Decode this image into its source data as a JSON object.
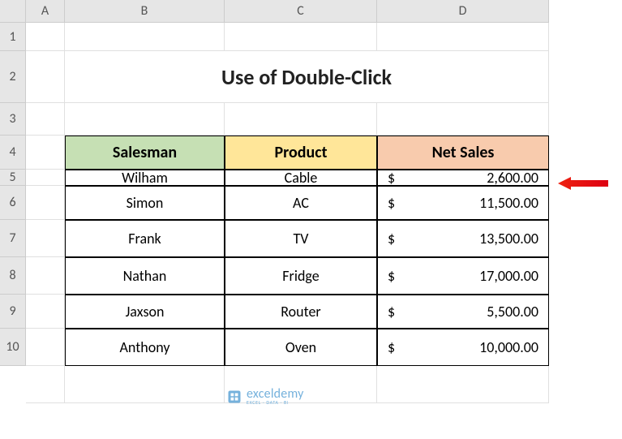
{
  "columns": [
    "A",
    "B",
    "C",
    "D"
  ],
  "rows": [
    "1",
    "2",
    "3",
    "4",
    "5",
    "6",
    "7",
    "8",
    "9",
    "10"
  ],
  "title": "Use of Double-Click",
  "headers": {
    "salesman": "Salesman",
    "product": "Product",
    "netsales": "Net Sales"
  },
  "tbl": [
    {
      "salesman": "Wilham",
      "product": "Cable",
      "cur": "$",
      "amount": "2,600.00"
    },
    {
      "salesman": "Simon",
      "product": "AC",
      "cur": "$",
      "amount": "11,500.00"
    },
    {
      "salesman": "Frank",
      "product": "TV",
      "cur": "$",
      "amount": "13,500.00"
    },
    {
      "salesman": "Nathan",
      "product": "Fridge",
      "cur": "$",
      "amount": "17,000.00"
    },
    {
      "salesman": "Jaxson",
      "product": "Router",
      "cur": "$",
      "amount": "5,500.00"
    },
    {
      "salesman": "Anthony",
      "product": "Oven",
      "cur": "$",
      "amount": "10,000.00"
    }
  ],
  "watermark": {
    "name": "exceldemy",
    "sub": "EXCEL · DATA · BI"
  },
  "chart_data": {
    "type": "table",
    "title": "Use of Double-Click",
    "columns": [
      "Salesman",
      "Product",
      "Net Sales"
    ],
    "rows": [
      [
        "Wilham",
        "Cable",
        2600.0
      ],
      [
        "Simon",
        "AC",
        11500.0
      ],
      [
        "Frank",
        "TV",
        13500.0
      ],
      [
        "Nathan",
        "Fridge",
        17000.0
      ],
      [
        "Jaxson",
        "Router",
        5500.0
      ],
      [
        "Anthony",
        "Oven",
        10000.0
      ]
    ]
  }
}
